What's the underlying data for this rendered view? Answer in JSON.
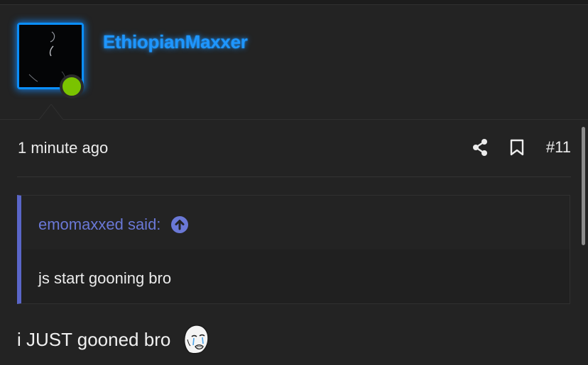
{
  "user": {
    "name": "EthiopianMaxxer",
    "online": true,
    "avatar_icon": "avatar-image",
    "accent_color": "#1e96ff",
    "online_color": "#7ac300"
  },
  "post": {
    "timestamp": "1 minute ago",
    "post_number": "#11",
    "share_icon": "share-icon",
    "bookmark_icon": "bookmark-icon",
    "quote": {
      "author_label": "emomaxxed said:",
      "jump_icon": "arrow-up-circle-icon",
      "text": "js start gooning bro",
      "accent_color": "#5a66c8"
    },
    "message": "i JUST gooned bro",
    "emoji_icon": "crying-wojak-emoji"
  }
}
